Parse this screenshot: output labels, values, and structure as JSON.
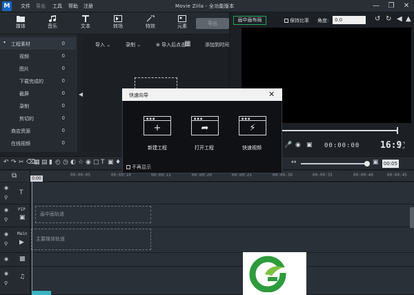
{
  "app": {
    "logo": "M",
    "title": "Movie Zilla - 全功能版本",
    "menu": [
      "文件",
      "导出",
      "工具",
      "帮助",
      "注册"
    ]
  },
  "toolbar": {
    "tools": [
      {
        "label": "媒体",
        "icon": "folder-icon"
      },
      {
        "label": "音乐",
        "icon": "music-note-icon"
      },
      {
        "label": "文本",
        "icon": "text-icon"
      },
      {
        "label": "转场",
        "icon": "transition-icon"
      },
      {
        "label": "特效",
        "icon": "effect-icon"
      },
      {
        "label": "元素",
        "icon": "elements-icon"
      }
    ],
    "export_label": "导出"
  },
  "sidebar": {
    "items": [
      {
        "label": "工程素材",
        "count": "0"
      },
      {
        "label": "视频",
        "count": "0"
      },
      {
        "label": "图片",
        "count": "0"
      },
      {
        "label": "下载完成的",
        "count": "0"
      },
      {
        "label": "截屏",
        "count": "0"
      },
      {
        "label": "录制",
        "count": "0"
      },
      {
        "label": "剪切的",
        "count": "0"
      },
      {
        "label": "商店资源",
        "count": "0"
      },
      {
        "label": "在线视频",
        "count": "0"
      }
    ]
  },
  "media_bar": {
    "import": "导入",
    "record": "录制",
    "import_hint": "导入后点击",
    "add_to_timeline": "添加到时间线"
  },
  "preview": {
    "pip_button": "画中画布局",
    "keep_ratio": "保持比率",
    "angle_label": "角度:",
    "angle_value": "0.0",
    "timecode": "00:00:00",
    "ratio": "16:9"
  },
  "timeline": {
    "zoom_value": "00:05",
    "ruler_ticks": [
      "00:00:05",
      "00:00:10",
      "00:00:15",
      "00:00:20",
      "00:00:25",
      "00:00:30",
      "00:00:35",
      "00:00:40",
      "00:00:45"
    ],
    "playhead": "0:00",
    "track_pip_label": "PIP",
    "track_main_label": "Main",
    "pip_zone": "画中画轨道",
    "main_zone": "主要媒体轨道"
  },
  "dialog": {
    "title": "快速向导",
    "options": [
      {
        "label": "新建工程",
        "icon": "plus-icon"
      },
      {
        "label": "打开工程",
        "icon": "share-arrow-icon"
      },
      {
        "label": "快速视频",
        "icon": "lightning-icon"
      }
    ],
    "no_show": "不再显示"
  },
  "colors": {
    "accent": "#1565c0",
    "pip_border": "#2aa35a",
    "scroll_accent": "#3bb3c3",
    "watermark_green": "#2e9b3c"
  }
}
